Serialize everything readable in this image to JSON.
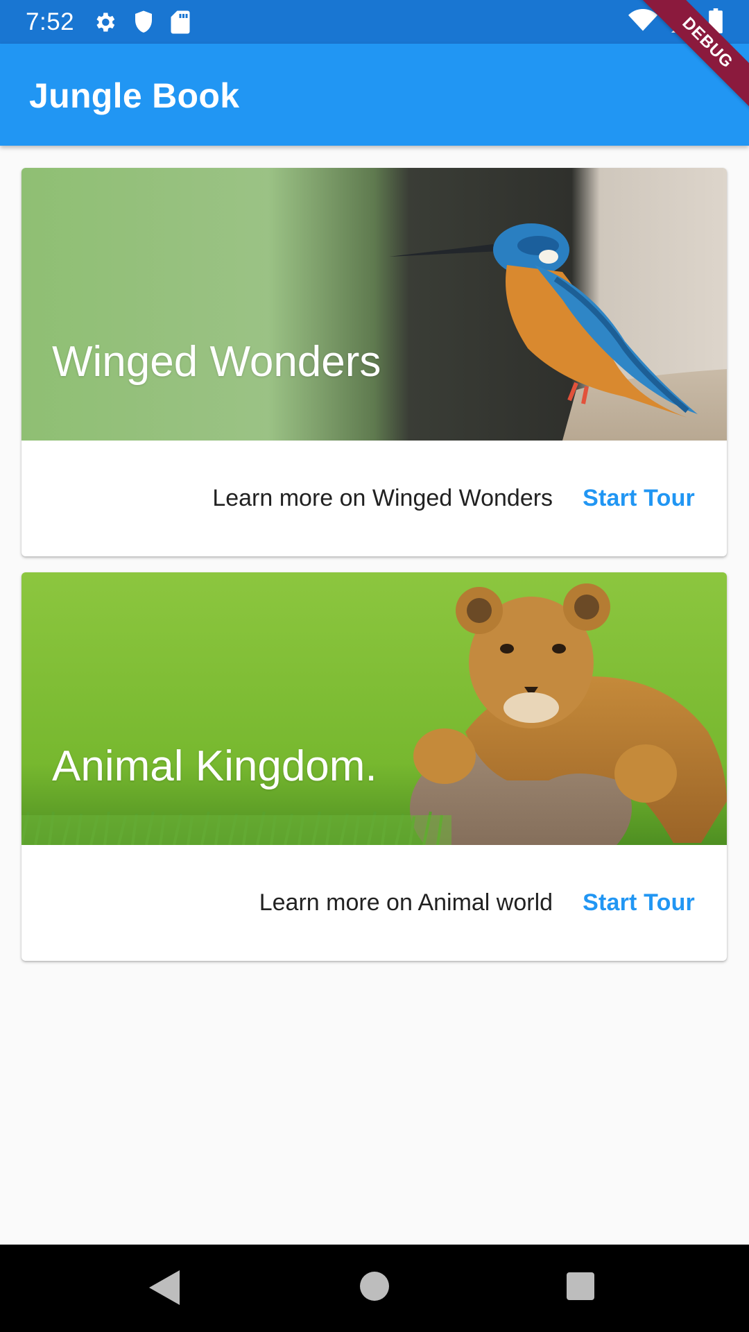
{
  "status_bar": {
    "time": "7:52",
    "left_icons": [
      "settings-icon",
      "shield-icon",
      "sd-card-icon"
    ],
    "right_icons": [
      "wifi-icon",
      "signal-icon",
      "battery-icon"
    ]
  },
  "app_bar": {
    "title": "Jungle Book"
  },
  "debug_banner": {
    "label": "DEBUG"
  },
  "cards": [
    {
      "title": "Winged Wonders",
      "image": "kingfisher-photo",
      "description": "Learn more on Winged Wonders",
      "button_label": "Start Tour"
    },
    {
      "title": "Animal Kingdom.",
      "image": "lion-cub-photo",
      "description": "Learn more on Animal world",
      "button_label": "Start Tour"
    }
  ],
  "nav_bar": {
    "buttons": [
      "back-icon",
      "home-icon",
      "recents-icon"
    ]
  },
  "colors": {
    "primary": "#2196f3",
    "status_bar": "#1976d2",
    "debug": "#8b1a3d"
  }
}
